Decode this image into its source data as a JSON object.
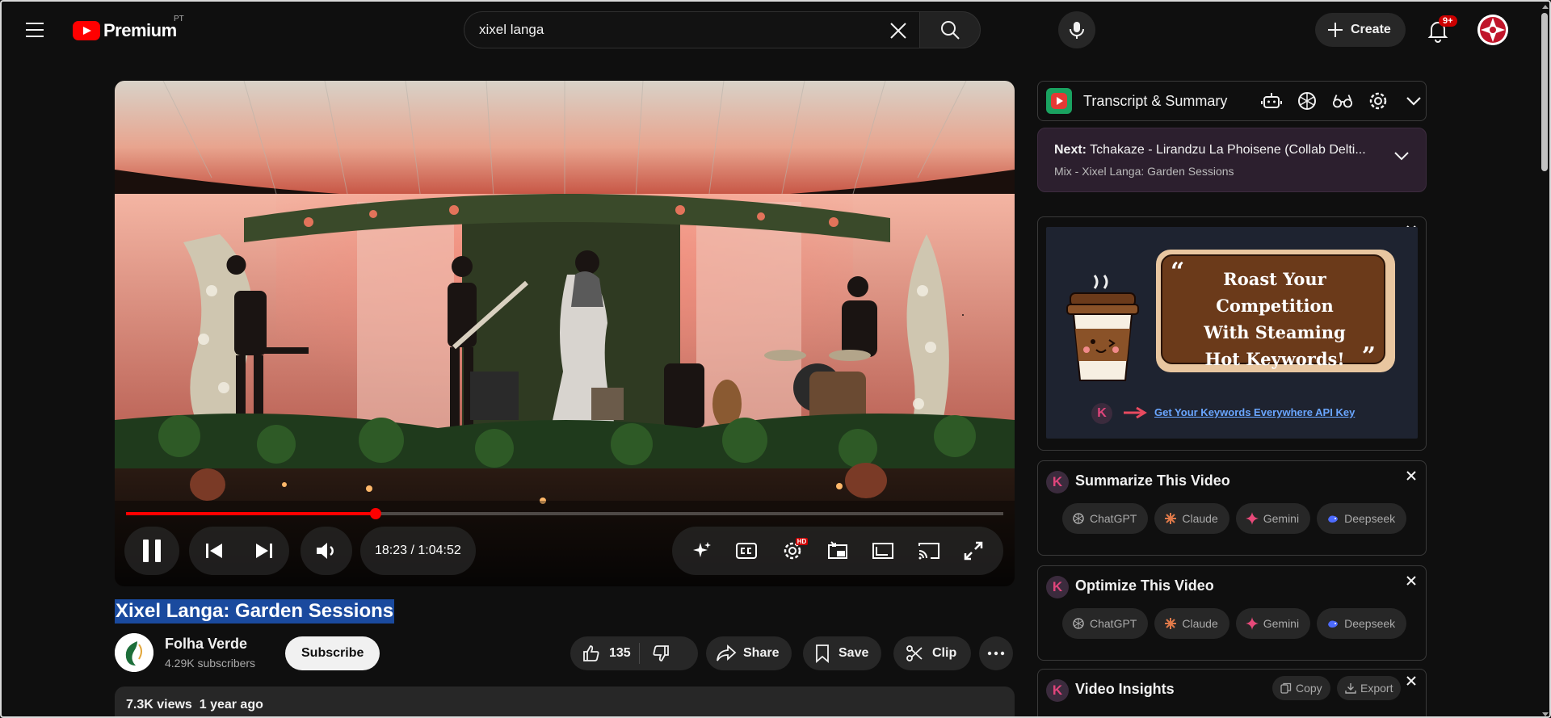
{
  "header": {
    "logo_text": "Premium",
    "region": "PT",
    "search_value": "xixel langa",
    "create_label": "Create",
    "notification_count": "9+"
  },
  "player": {
    "time_current": "18:23",
    "time_total": "1:04:52",
    "time_separator": "/",
    "progress_played": 0.2842,
    "progress_color": "#ff0000",
    "hd_badge": "HD"
  },
  "video": {
    "title": "Xixel Langa: Garden Sessions",
    "channel_name": "Folha Verde",
    "subscribers": "4.29K subscribers",
    "subscribe_label": "Subscribe",
    "likes": "135",
    "share_label": "Share",
    "save_label": "Save",
    "clip_label": "Clip",
    "views": "7.3K views",
    "age": "1 year ago"
  },
  "sidebar": {
    "transcript_title": "Transcript & Summary",
    "next_label": "Next:",
    "next_title": "Tchakaze - Lirandzu La Phoisene (Collab Delti...",
    "next_mix": "Mix - Xixel Langa: Garden Sessions",
    "ad_lines": [
      "Roast Your",
      "Competition",
      "With Steaming",
      "Hot Keywords!"
    ],
    "ad_link": "Get Your Keywords Everywhere API Key",
    "k_letter": "K",
    "summarize_title": "Summarize This Video",
    "optimize_title": "Optimize This Video",
    "insights_title": "Video Insights",
    "copy_label": "Copy",
    "export_label": "Export",
    "chips": [
      "ChatGPT",
      "Claude",
      "Gemini",
      "Deepseek"
    ]
  },
  "colors": {
    "accent_red": "#ff0000",
    "brand_k": "#e0457b",
    "next_bg": "#2c1f2e",
    "transcript_logo": "#1aa260"
  }
}
